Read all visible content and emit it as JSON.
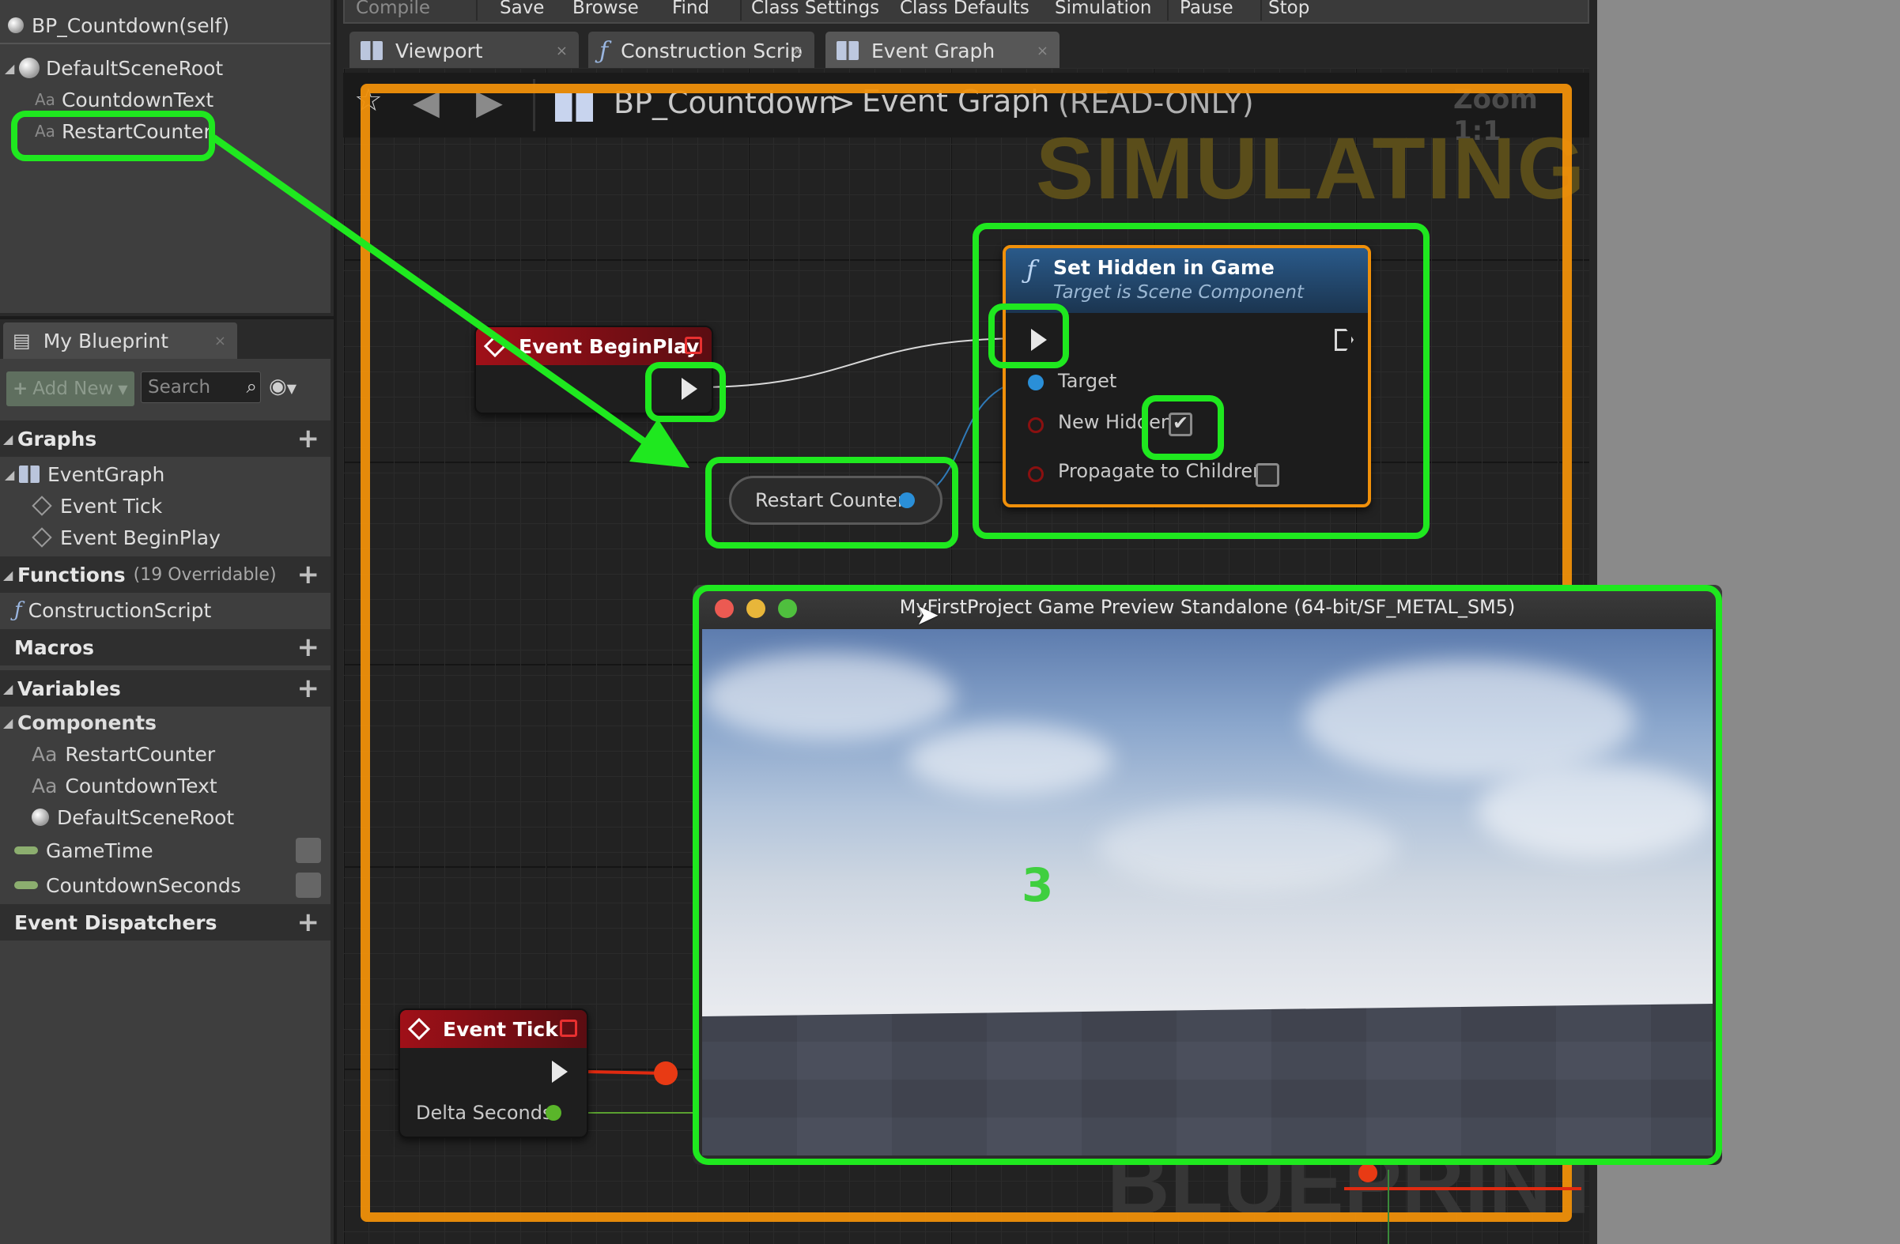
{
  "components": {
    "self_label": "BP_Countdown(self)",
    "items": [
      {
        "label": "DefaultSceneRoot"
      },
      {
        "label": "CountdownText"
      },
      {
        "label": "RestartCounter"
      }
    ]
  },
  "my_blueprint": {
    "tab_label": "My Blueprint",
    "add_new_label": "Add New",
    "search_placeholder": "Search",
    "sections": {
      "graphs": "Graphs",
      "functions": "Functions",
      "functions_sub": "(19 Overridable)",
      "macros": "Macros",
      "variables": "Variables",
      "components": "Components",
      "event_dispatchers": "Event Dispatchers"
    },
    "graphs": [
      "EventGraph",
      "Event Tick",
      "Event BeginPlay"
    ],
    "functions": [
      "ConstructionScript"
    ],
    "components": [
      "RestartCounter",
      "CountdownText",
      "DefaultSceneRoot"
    ],
    "variables": [
      "GameTime",
      "CountdownSeconds"
    ]
  },
  "menubar": [
    "Compile",
    "Save",
    "Browse",
    "Find",
    "Class Settings",
    "Class Defaults",
    "Simulation",
    "Pause",
    "Stop"
  ],
  "tabs": [
    "Viewport",
    "Construction Scrip",
    "Event Graph"
  ],
  "breadcrumb": {
    "blueprint": "BP_Countdown",
    "separator": ">",
    "graph": "Event Graph",
    "mode": "(READ-ONLY)",
    "zoom": "Zoom 1:1"
  },
  "watermarks": {
    "simulating": "SIMULATING",
    "blueprint": "BLUEPRINT"
  },
  "nodes": {
    "begin_play": {
      "title": "Event BeginPlay"
    },
    "restart_counter": {
      "label": "Restart Counter"
    },
    "set_hidden": {
      "title": "Set Hidden in Game",
      "subtitle": "Target is Scene Component",
      "pins": {
        "target": "Target",
        "new_hidden": "New Hidden",
        "propagate": "Propagate to Children"
      },
      "new_hidden_checked": true,
      "propagate_checked": false
    },
    "event_tick": {
      "title": "Event Tick",
      "pin": "Delta Seconds"
    }
  },
  "preview_window": {
    "title": "MyFirstProject Game Preview Standalone (64-bit/SF_METAL_SM5)",
    "countdown_value": "3"
  },
  "colors": {
    "highlight": "#1fe81f",
    "simulating_frame": "#f0900a",
    "event_node": "#a01018",
    "function_node": "#2a5a8a",
    "countdown_text": "#3fcf3f"
  }
}
